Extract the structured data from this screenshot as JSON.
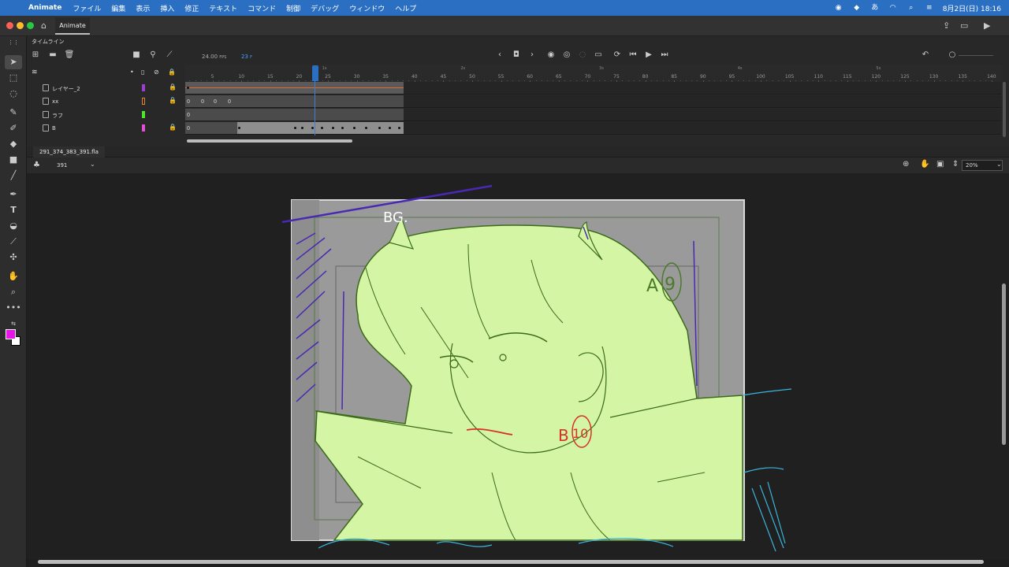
{
  "menubar": {
    "app": "Animate",
    "items": [
      "ファイル",
      "編集",
      "表示",
      "挿入",
      "修正",
      "テキスト",
      "コマンド",
      "制御",
      "デバッグ",
      "ウィンドウ",
      "ヘルプ"
    ],
    "clock": "8月2日(日) 18:16",
    "input_mode": "あ"
  },
  "window": {
    "tab": "Animate"
  },
  "timeline": {
    "title": "タイムライン",
    "fps": "24.00",
    "fps_unit": "FPS",
    "current_frame": "23",
    "current_frame_unit": "F",
    "ruler_ticks": [
      "5",
      "10",
      "15",
      "20",
      "25",
      "30",
      "35",
      "40",
      "45",
      "50",
      "55",
      "60",
      "65",
      "70",
      "75",
      "80",
      "85",
      "90",
      "95",
      "100",
      "105",
      "110",
      "115",
      "120",
      "125",
      "130",
      "135",
      "140"
    ],
    "second_marks": [
      "1s",
      "2s",
      "3s",
      "4s",
      "5s"
    ],
    "layers": [
      {
        "name": "レイヤー_2",
        "color": "#9b3fd1"
      },
      {
        "name": "xx",
        "color": "#e0872a"
      },
      {
        "name": "ラフ",
        "color": "#4ee62d"
      },
      {
        "name": "B",
        "color": "#e04fd8"
      }
    ]
  },
  "document": {
    "filename": "291_374_383_391.fla",
    "scene": "391",
    "zoom": "20%"
  },
  "stage": {
    "annotations": {
      "bg": "BG.",
      "a": "A",
      "a_circled": "9",
      "b": "B",
      "b_circled": "10"
    }
  },
  "colors": {
    "fill": "#e815e8",
    "stroke": "#ffffff",
    "accent": "#2b6fc2"
  }
}
